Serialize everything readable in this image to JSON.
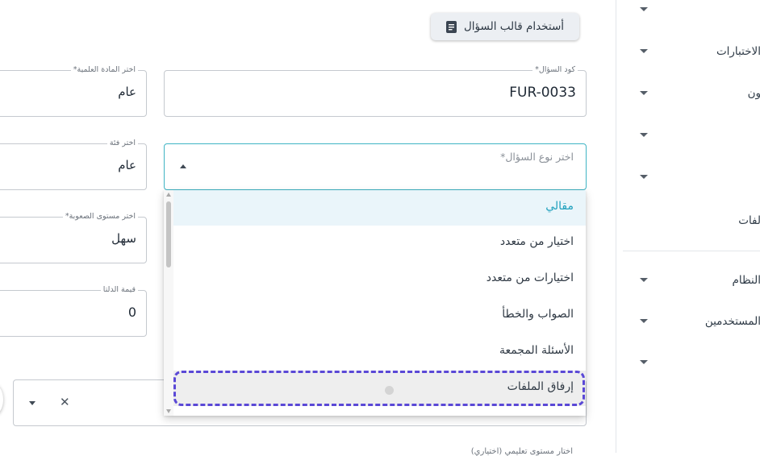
{
  "template_button": {
    "label": "أستخدام قالب السؤال",
    "icon": "document-icon"
  },
  "fields": {
    "question_code": {
      "legend": "كود السؤال*",
      "value": "FUR-0033"
    },
    "subject": {
      "legend": "اختر المادة العلمية*",
      "value": "عام"
    },
    "question_type": {
      "legend": "اختر نوع السؤال*",
      "value": ""
    },
    "category": {
      "legend": "اختر فئة",
      "value": "عام"
    },
    "difficulty": {
      "legend": "اختر مستوى الصعوبة*",
      "value": "سهل"
    },
    "delta": {
      "legend": "قيمة الدلتا",
      "value": "0"
    },
    "bottom_hint": {
      "legend": "اختار مستوى تعليمي (اختياري)"
    }
  },
  "dropdown": {
    "options": [
      {
        "label": "مقالي",
        "state": "selected"
      },
      {
        "label": "اختيار من متعدد",
        "state": ""
      },
      {
        "label": "اختيارات من متعدد",
        "state": ""
      },
      {
        "label": "الصواب والخطأ",
        "state": ""
      },
      {
        "label": "الأسئلة المجمعة",
        "state": ""
      },
      {
        "label": "إرفاق الملفات",
        "state": "focused"
      }
    ]
  },
  "sidebar": {
    "items": [
      {
        "label": ""
      },
      {
        "label": "الاختبارات"
      },
      {
        "label": "ون"
      },
      {
        "label": ""
      },
      {
        "label": ""
      },
      {
        "label": "لفات"
      },
      {
        "label": "النظام"
      },
      {
        "label": "المستخدمين"
      },
      {
        "label": ""
      }
    ]
  },
  "colors": {
    "accent": "#1fa0bd",
    "focus_ring": "#5a48d6",
    "selected_bg": "#eaf5fa"
  }
}
